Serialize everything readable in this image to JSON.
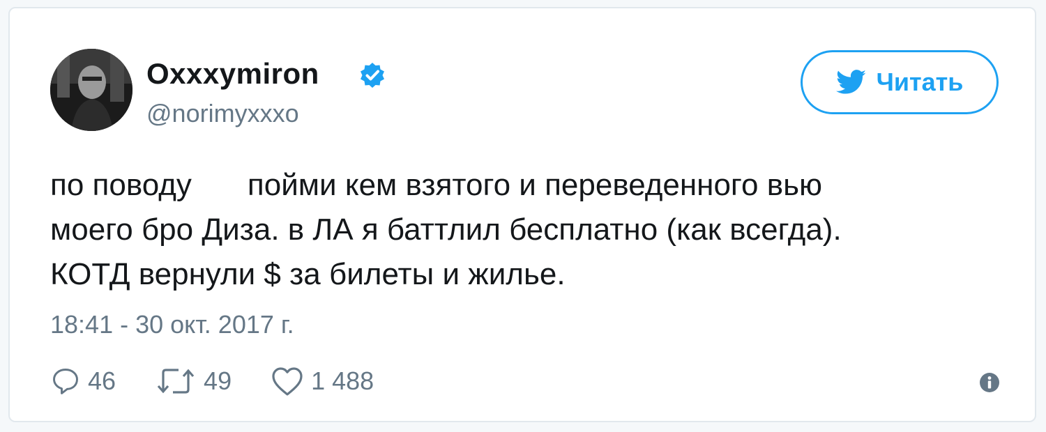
{
  "tweet": {
    "display_name": "Oxxxymiron",
    "handle": "@norimyxxxo",
    "follow_label": "Читать",
    "text_line_1a": "по поводу",
    "text_line_1b": "пойми кем взятого и переведенного вью",
    "text_line_2": "моего бро Диза. в ЛА я баттлил бесплатно (как всегда).",
    "text_line_3": "КОТД вернули $ за билеты и жилье.",
    "timestamp": "18:41 - 30 окт. 2017 г.",
    "replies": "46",
    "retweets": "49",
    "likes": "1 488"
  },
  "icons": {
    "verified": "verified-badge-icon",
    "twitter": "twitter-bird-icon",
    "reply": "reply-icon",
    "retweet": "retweet-icon",
    "like": "heart-icon",
    "info": "info-icon"
  },
  "colors": {
    "accent": "#1da1f2",
    "muted": "#657786",
    "text": "#14171a",
    "border": "#e1e8ed"
  }
}
